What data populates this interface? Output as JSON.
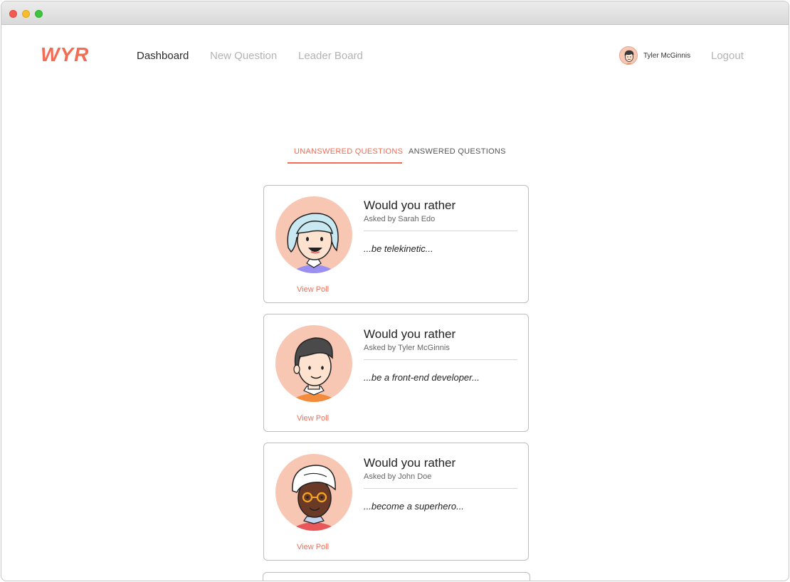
{
  "brand": {
    "logo": "WYR",
    "accent": "#f36c54"
  },
  "nav": {
    "dashboard": "Dashboard",
    "new_question": "New Question",
    "leader_board": "Leader Board"
  },
  "user": {
    "name": "Tyler McGinnis",
    "logout": "Logout",
    "avatar_icon": "user-avatar"
  },
  "tabs": {
    "unanswered": "UNANSWERED QUESTIONS",
    "answered": "ANSWERED QUESTIONS",
    "active": "unanswered"
  },
  "questions": [
    {
      "title": "Would you rather",
      "asked_by": "Asked by Sarah Edo",
      "preview": "...be telekinetic...",
      "action": "View Poll",
      "avatar": "sarah-avatar"
    },
    {
      "title": "Would you rather",
      "asked_by": "Asked by Tyler McGinnis",
      "preview": "...be a front-end developer...",
      "action": "View Poll",
      "avatar": "tyler-avatar"
    },
    {
      "title": "Would you rather",
      "asked_by": "Asked by John Doe",
      "preview": "...become a superhero...",
      "action": "View Poll",
      "avatar": "john-avatar"
    }
  ]
}
